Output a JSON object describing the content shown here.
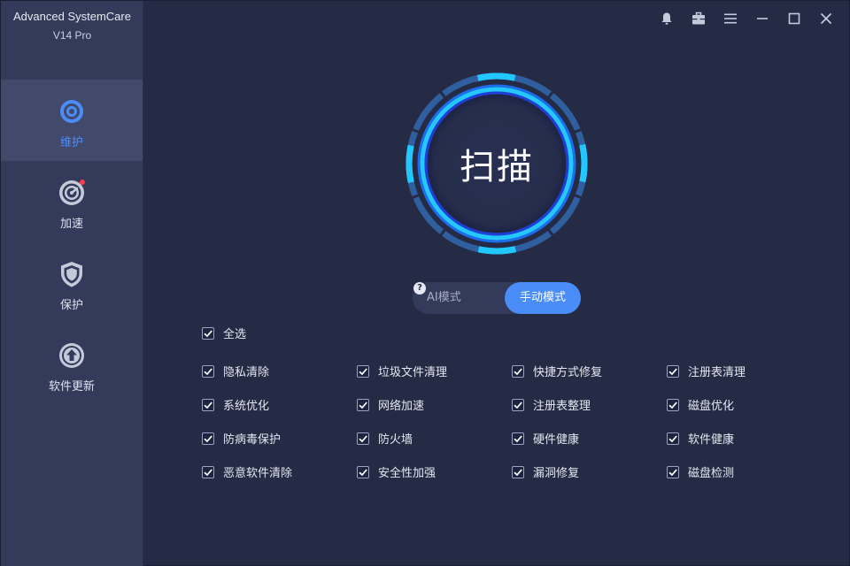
{
  "app": {
    "name": "Advanced SystemCare",
    "version": "V14 Pro"
  },
  "sidebar": {
    "items": [
      {
        "label": "维护",
        "icon": "maintain-icon",
        "active": true
      },
      {
        "label": "加速",
        "icon": "speedometer-icon",
        "active": false,
        "badge": true
      },
      {
        "label": "保护",
        "icon": "shield-icon",
        "active": false
      },
      {
        "label": "软件更新",
        "icon": "upload-icon",
        "active": false
      }
    ]
  },
  "window_controls": [
    "bell-icon",
    "toolbox-icon",
    "menu-icon",
    "minimize-icon",
    "maximize-icon",
    "close-icon"
  ],
  "scan": {
    "label": "扫描"
  },
  "mode": {
    "ai_label": "AI模式",
    "manual_label": "手动模式",
    "help": "?",
    "selected": "manual"
  },
  "select_all": {
    "label": "全选",
    "checked": true
  },
  "checklist": [
    [
      {
        "label": "隐私清除",
        "checked": true
      },
      {
        "label": "系统优化",
        "checked": true
      },
      {
        "label": "防病毒保护",
        "checked": true
      },
      {
        "label": "恶意软件清除",
        "checked": true
      }
    ],
    [
      {
        "label": "垃圾文件清理",
        "checked": true
      },
      {
        "label": "网络加速",
        "checked": true
      },
      {
        "label": "防火墙",
        "checked": true
      },
      {
        "label": "安全性加强",
        "checked": true
      }
    ],
    [
      {
        "label": "快捷方式修复",
        "checked": true
      },
      {
        "label": "注册表整理",
        "checked": true
      },
      {
        "label": "硬件健康",
        "checked": true
      },
      {
        "label": "漏洞修复",
        "checked": true
      }
    ],
    [
      {
        "label": "注册表清理",
        "checked": true
      },
      {
        "label": "磁盘优化",
        "checked": true
      },
      {
        "label": "软件健康",
        "checked": true
      },
      {
        "label": "磁盘检测",
        "checked": true
      }
    ]
  ],
  "colors": {
    "accent": "#4a8df8",
    "ring_glow": "#24c8ff",
    "ring_track": "#2e62a8",
    "badge": "#ff3b4e"
  }
}
